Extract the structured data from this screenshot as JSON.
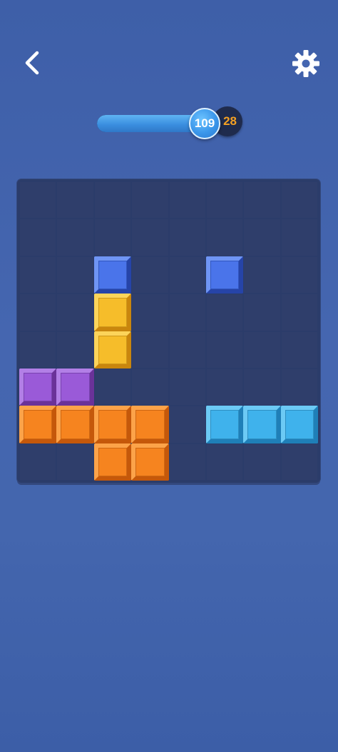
{
  "header": {
    "back_icon": "chevron-left-icon",
    "settings_icon": "gear-icon"
  },
  "score": {
    "current": "109",
    "best": "28",
    "progress_fraction": 0.85
  },
  "board": {
    "rows": 8,
    "cols": 8,
    "background": "#2b3c6a",
    "cell_color": "#2f3e6b",
    "blocks": [
      {
        "row": 2,
        "col": 2,
        "color": "blue"
      },
      {
        "row": 2,
        "col": 5,
        "color": "blue"
      },
      {
        "row": 3,
        "col": 2,
        "color": "yellow"
      },
      {
        "row": 4,
        "col": 2,
        "color": "yellow"
      },
      {
        "row": 5,
        "col": 0,
        "color": "purple"
      },
      {
        "row": 5,
        "col": 1,
        "color": "purple"
      },
      {
        "row": 6,
        "col": 0,
        "color": "orange"
      },
      {
        "row": 6,
        "col": 1,
        "color": "orange"
      },
      {
        "row": 6,
        "col": 2,
        "color": "orange"
      },
      {
        "row": 6,
        "col": 3,
        "color": "orange"
      },
      {
        "row": 6,
        "col": 5,
        "color": "cyan"
      },
      {
        "row": 6,
        "col": 6,
        "color": "cyan"
      },
      {
        "row": 6,
        "col": 7,
        "color": "cyan"
      },
      {
        "row": 7,
        "col": 2,
        "color": "orange"
      },
      {
        "row": 7,
        "col": 3,
        "color": "orange"
      }
    ]
  },
  "colors": {
    "blue": {
      "base": "#3d67e0",
      "light": "#6f95f5",
      "dark": "#2644a8",
      "face": "#4a74ea"
    },
    "yellow": {
      "base": "#f2b31f",
      "light": "#fcd45a",
      "dark": "#c9860d",
      "face": "#f6bd2a"
    },
    "purple": {
      "base": "#8f4fcf",
      "light": "#b27fe6",
      "dark": "#6a3299",
      "face": "#9a5ad8"
    },
    "orange": {
      "base": "#f27a17",
      "light": "#fca349",
      "dark": "#c5580a",
      "face": "#f6841f"
    },
    "cyan": {
      "base": "#35a8e6",
      "light": "#6ccaf5",
      "dark": "#1f7fb8",
      "face": "#3fb2ec"
    }
  }
}
